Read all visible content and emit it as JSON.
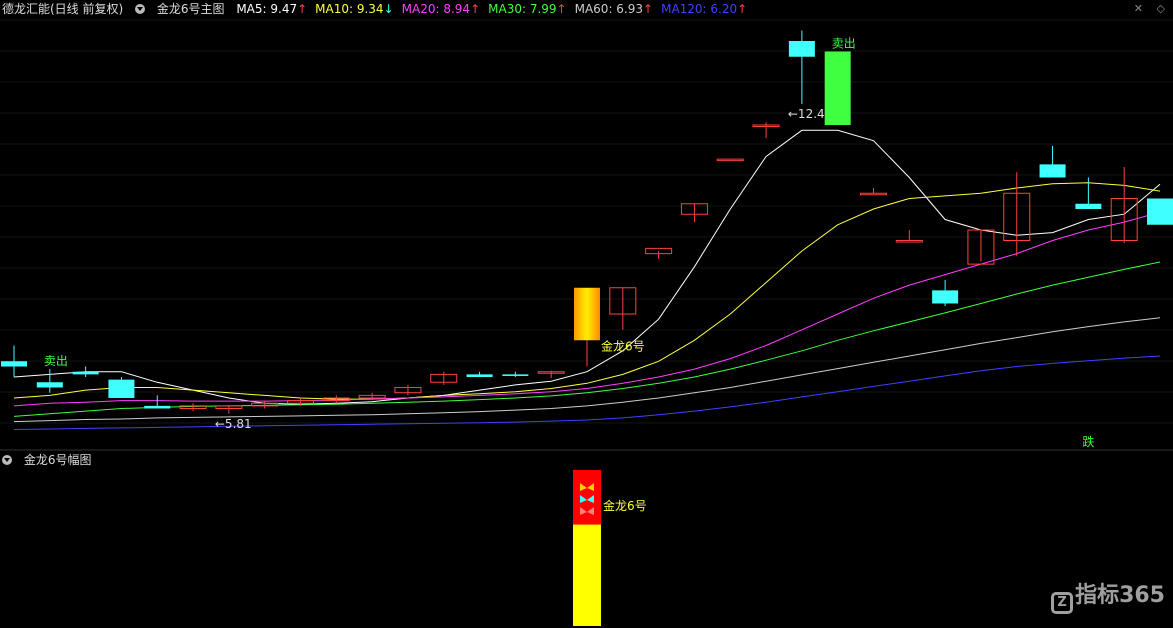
{
  "header": {
    "stock": "德龙汇能(日线 前复权)",
    "indicator": "金龙6号主图",
    "ma": [
      {
        "label": "MA5: 9.47",
        "arrow": "↑",
        "color": "#ffffff",
        "arrow_color": "#ff4040"
      },
      {
        "label": "MA10: 9.34",
        "arrow": "↓",
        "color": "#ffff40",
        "arrow_color": "#40ffff"
      },
      {
        "label": "MA20: 8.94",
        "arrow": "↑",
        "color": "#ff40ff",
        "arrow_color": "#ff4040"
      },
      {
        "label": "MA30: 7.99",
        "arrow": "↑",
        "color": "#40ff40",
        "arrow_color": "#ff4040"
      },
      {
        "label": "MA60: 6.93",
        "arrow": "↑",
        "color": "#cccccc",
        "arrow_color": "#ff4040"
      },
      {
        "label": "MA120: 6.20",
        "arrow": "↑",
        "color": "#4040ff",
        "arrow_color": "#ff4040"
      }
    ]
  },
  "sub_header": {
    "indicator": "金龙6号幅图"
  },
  "controls": {
    "close": "✕",
    "diamond": "◇"
  },
  "watermark": {
    "text": "指标365",
    "icon": "Z"
  },
  "colors": {
    "up": "#ff4040",
    "down": "#40ffff",
    "signal": "#40ff40",
    "buy": "#ffff00",
    "sell_bar": "#ff0000"
  },
  "chart_data": [
    {
      "type": "candlestick",
      "candles": [
        [
          6.1,
          6.4,
          5.8,
          6.0
        ],
        [
          5.7,
          5.95,
          5.5,
          5.6
        ],
        [
          5.9,
          6.0,
          5.8,
          5.85
        ],
        [
          5.75,
          5.8,
          5.45,
          5.4
        ],
        [
          5.25,
          5.45,
          5.2,
          5.2
        ],
        [
          5.2,
          5.3,
          5.15,
          5.25
        ],
        [
          5.2,
          5.25,
          5.1,
          5.25
        ],
        [
          5.25,
          5.35,
          5.2,
          5.3
        ],
        [
          5.3,
          5.4,
          5.25,
          5.35
        ],
        [
          5.35,
          5.45,
          5.3,
          5.4
        ],
        [
          5.4,
          5.5,
          5.38,
          5.45
        ],
        [
          5.5,
          5.65,
          5.45,
          5.6
        ],
        [
          5.7,
          5.9,
          5.65,
          5.85
        ],
        [
          5.85,
          5.9,
          5.8,
          5.8
        ],
        [
          5.85,
          5.9,
          5.8,
          5.82
        ],
        [
          5.88,
          5.92,
          5.78,
          5.9
        ],
        [
          6.0,
          6.5,
          6.0,
          6.5
        ],
        [
          7.0,
          7.5,
          6.7,
          7.5
        ],
        [
          8.15,
          8.2,
          8.05,
          8.25
        ],
        [
          8.9,
          9.1,
          8.75,
          9.1
        ],
        [
          9.95,
          9.95,
          9.95,
          9.95
        ],
        [
          10.6,
          10.65,
          10.35,
          10.6
        ],
        [
          12.2,
          12.4,
          11.0,
          11.9
        ],
        [
          12.0,
          12.0,
          10.6,
          10.6
        ],
        [
          9.3,
          9.4,
          9.3,
          9.3
        ],
        [
          8.4,
          8.6,
          8.4,
          8.4
        ],
        [
          7.45,
          7.65,
          7.15,
          7.2
        ],
        [
          7.95,
          8.0,
          8.6,
          8.6
        ],
        [
          8.4,
          9.7,
          8.1,
          9.3
        ],
        [
          9.85,
          10.2,
          9.6,
          9.6
        ],
        [
          9.1,
          9.6,
          9.0,
          9.0
        ],
        [
          8.4,
          9.8,
          8.35,
          9.2
        ],
        [
          9.2,
          9.2,
          8.7,
          8.7
        ]
      ],
      "ma_series": [
        {
          "name": "MA5",
          "color": "#ffffff",
          "values": [
            5.8,
            5.85,
            5.9,
            5.9,
            5.7,
            5.55,
            5.4,
            5.3,
            5.28,
            5.3,
            5.33,
            5.4,
            5.45,
            5.55,
            5.65,
            5.72,
            5.9,
            6.3,
            6.9,
            7.9,
            9.0,
            10.0,
            10.5,
            10.5,
            10.3,
            9.6,
            8.8,
            8.6,
            8.5,
            8.55,
            8.8,
            8.9,
            9.47
          ]
        },
        {
          "name": "MA10",
          "color": "#ffff40",
          "values": [
            5.4,
            5.45,
            5.55,
            5.6,
            5.6,
            5.55,
            5.5,
            5.45,
            5.4,
            5.38,
            5.38,
            5.4,
            5.45,
            5.48,
            5.52,
            5.58,
            5.68,
            5.85,
            6.1,
            6.5,
            7.0,
            7.6,
            8.2,
            8.7,
            9.0,
            9.2,
            9.25,
            9.3,
            9.4,
            9.48,
            9.5,
            9.45,
            9.34
          ]
        },
        {
          "name": "MA20",
          "color": "#ff40ff",
          "values": [
            5.25,
            5.3,
            5.32,
            5.35,
            5.35,
            5.34,
            5.34,
            5.34,
            5.35,
            5.36,
            5.38,
            5.4,
            5.42,
            5.45,
            5.48,
            5.52,
            5.58,
            5.68,
            5.8,
            5.95,
            6.15,
            6.4,
            6.7,
            7.0,
            7.3,
            7.55,
            7.75,
            7.95,
            8.15,
            8.4,
            8.6,
            8.75,
            8.94
          ]
        },
        {
          "name": "MA30",
          "color": "#40ff40",
          "values": [
            5.05,
            5.1,
            5.15,
            5.2,
            5.22,
            5.24,
            5.25,
            5.26,
            5.27,
            5.28,
            5.3,
            5.32,
            5.34,
            5.37,
            5.4,
            5.44,
            5.5,
            5.58,
            5.68,
            5.8,
            5.95,
            6.12,
            6.3,
            6.5,
            6.68,
            6.85,
            7.02,
            7.2,
            7.38,
            7.55,
            7.7,
            7.85,
            7.99
          ]
        },
        {
          "name": "MA60",
          "color": "#cccccc",
          "values": [
            4.95,
            4.97,
            4.99,
            5.0,
            5.02,
            5.03,
            5.04,
            5.05,
            5.06,
            5.07,
            5.08,
            5.1,
            5.12,
            5.14,
            5.17,
            5.2,
            5.25,
            5.32,
            5.4,
            5.5,
            5.6,
            5.72,
            5.84,
            5.96,
            6.08,
            6.2,
            6.32,
            6.44,
            6.55,
            6.66,
            6.76,
            6.85,
            6.93
          ]
        },
        {
          "name": "MA120",
          "color": "#4040ff",
          "values": [
            4.8,
            4.81,
            4.82,
            4.83,
            4.84,
            4.85,
            4.86,
            4.87,
            4.88,
            4.89,
            4.9,
            4.91,
            4.92,
            4.93,
            4.94,
            4.96,
            4.98,
            5.02,
            5.08,
            5.15,
            5.23,
            5.32,
            5.42,
            5.52,
            5.62,
            5.72,
            5.82,
            5.92,
            6.0,
            6.06,
            6.11,
            6.16,
            6.2
          ]
        }
      ],
      "ylim": [
        4.6,
        12.6
      ],
      "annotations": [
        {
          "index": 1,
          "text": "卖出",
          "color": "#40ff40"
        },
        {
          "index": 6,
          "text": "←5.81",
          "color": "#dddddd"
        },
        {
          "index": 22,
          "text": "←12.4",
          "color": "#dddddd"
        },
        {
          "index": 23,
          "text": "卖出",
          "color": "#40ff40"
        },
        {
          "index": 16,
          "text": "金龙6号",
          "color": "#ffff40"
        },
        {
          "index": 30,
          "text": "跌",
          "color": "#40ff40"
        }
      ],
      "signal_candle": {
        "index": 16,
        "value": 6.5
      },
      "sell_candle": {
        "index": 23
      }
    },
    {
      "type": "bar",
      "signal_index": 16,
      "signal_label": "金龙6号",
      "values": [
        {
          "index": 16,
          "red": 0.35,
          "yellow": 1.0
        }
      ]
    }
  ]
}
